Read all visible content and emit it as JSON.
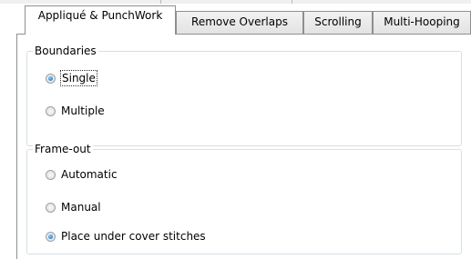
{
  "tabs": {
    "row_front": [
      {
        "label": "Appliqué & PunchWork",
        "active": true
      },
      {
        "label": "Remove Overlaps",
        "active": false
      },
      {
        "label": "Scrolling",
        "active": false
      },
      {
        "label": "Multi-Hooping",
        "active": false
      }
    ]
  },
  "boundaries": {
    "legend": "Boundaries",
    "options": [
      {
        "label": "Single",
        "checked": true,
        "focused": true
      },
      {
        "label": "Multiple",
        "checked": false
      }
    ]
  },
  "frame_out": {
    "legend": "Frame-out",
    "options": [
      {
        "label": "Automatic",
        "checked": false
      },
      {
        "label": "Manual",
        "checked": false
      },
      {
        "label": "Place under cover stitches",
        "checked": true
      }
    ]
  }
}
